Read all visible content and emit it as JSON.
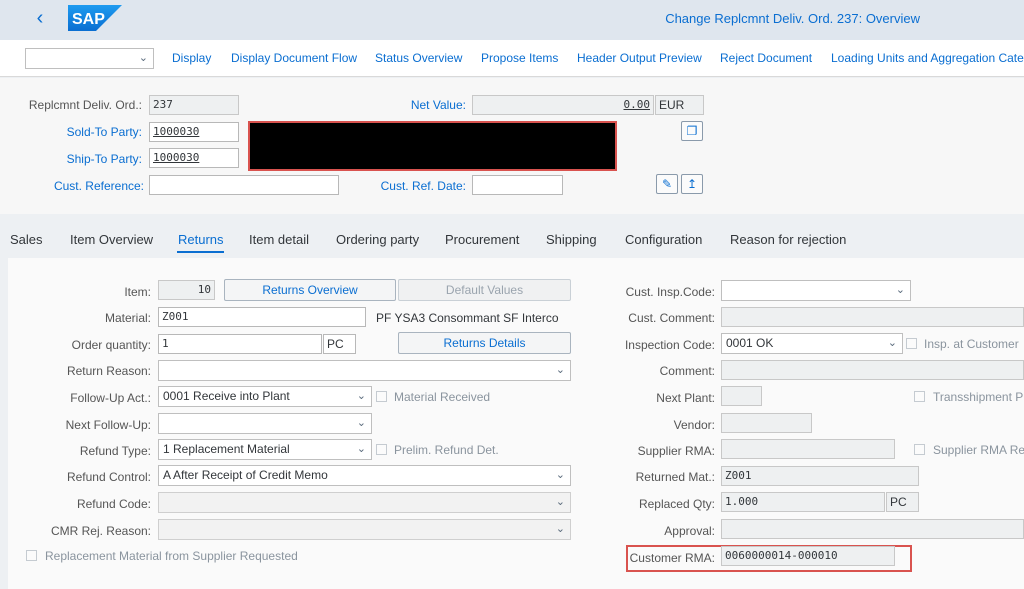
{
  "header": {
    "logo_text": "SAP",
    "title": "Change Replcmnt Deliv. Ord. 237: Overview",
    "back_icon": "chevron-left-icon"
  },
  "toolbar": {
    "dropdown_value": "",
    "buttons": [
      "Display",
      "Display Document Flow",
      "Status Overview",
      "Propose Items",
      "Header Output Preview",
      "Reject Document",
      "Loading Units and Aggregation Categ"
    ]
  },
  "header_form": {
    "order_label": "Replcmnt Deliv. Ord.:",
    "order_value": "237",
    "net_value_label": "Net Value:",
    "net_value": "0.00",
    "currency": "EUR",
    "sold_to_label": "Sold-To Party:",
    "sold_to_value": "1000030",
    "ship_to_label": "Ship-To Party:",
    "ship_to_value": "1000030",
    "cust_ref_label": "Cust. Reference:",
    "cust_ref_value": "",
    "cust_ref_date_label": "Cust. Ref. Date:",
    "cust_ref_date_value": ""
  },
  "tabs": [
    "Sales",
    "Item Overview",
    "Returns",
    "Item detail",
    "Ordering party",
    "Procurement",
    "Shipping",
    "Configuration",
    "Reason for rejection"
  ],
  "active_tab": "Returns",
  "returns": {
    "left": {
      "item_label": "Item:",
      "item_value": "10",
      "returns_overview_btn": "Returns Overview",
      "default_values_btn": "Default Values",
      "material_label": "Material:",
      "material_value": "Z001",
      "material_desc": "PF YSA3 Consommant SF Interco",
      "order_qty_label": "Order quantity:",
      "order_qty_value": "1",
      "order_qty_unit": "PC",
      "returns_details_btn": "Returns Details",
      "return_reason_label": "Return Reason:",
      "return_reason_value": "",
      "followup_label": "Follow-Up Act.:",
      "followup_value": "0001 Receive into Plant",
      "material_received_label": "Material Received",
      "next_followup_label": "Next Follow-Up:",
      "next_followup_value": "",
      "refund_type_label": "Refund Type:",
      "refund_type_value": "1 Replacement Material",
      "prelim_refund_label": "Prelim. Refund Det.",
      "refund_control_label": "Refund Control:",
      "refund_control_value": "A After Receipt of Credit Memo",
      "refund_code_label": "Refund Code:",
      "refund_code_value": "",
      "cmr_rej_label": "CMR Rej. Reason:",
      "cmr_rej_value": "",
      "replacement_supplier_label": "Replacement Material from Supplier Requested"
    },
    "right": {
      "cust_insp_label": "Cust. Insp.Code:",
      "cust_insp_value": "",
      "cust_comment_label": "Cust. Comment:",
      "cust_comment_value": "",
      "insp_code_label": "Inspection Code:",
      "insp_code_value": "0001 OK",
      "insp_at_customer_label": "Insp. at Customer",
      "comment_label": "Comment:",
      "comment_value": "",
      "next_plant_label": "Next Plant:",
      "next_plant_value": "",
      "transshipment_label": "Transshipment Pl",
      "vendor_label": "Vendor:",
      "vendor_value": "",
      "supplier_rma_label": "Supplier RMA:",
      "supplier_rma_value": "",
      "supplier_rma_req_label": "Supplier RMA Rec",
      "returned_mat_label": "Returned Mat.:",
      "returned_mat_value": "Z001",
      "replaced_qty_label": "Replaced Qty:",
      "replaced_qty_value": "1.000",
      "replaced_qty_unit": "PC",
      "approval_label": "Approval:",
      "approval_value": "",
      "customer_rma_label": "Customer RMA:",
      "customer_rma_value": "0060000014-000010"
    }
  },
  "colors": {
    "accent": "#0a6ed1",
    "header_bg": "#dfe6ee",
    "redaction": "#000000",
    "highlight_border": "#d9534f"
  }
}
